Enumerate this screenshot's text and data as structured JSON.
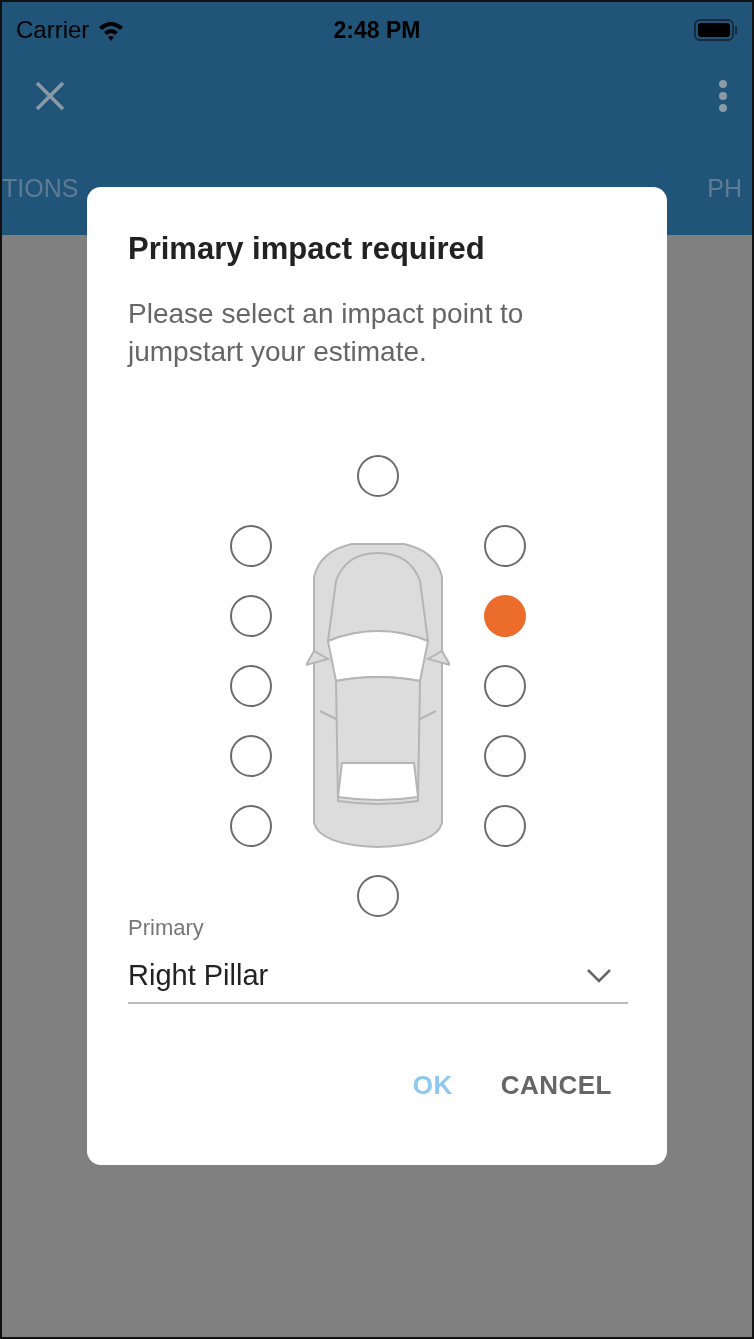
{
  "status_bar": {
    "carrier": "Carrier",
    "time": "2:48 PM"
  },
  "tabs": [
    {
      "label": "TIONS",
      "selected": false
    },
    {
      "label": "PH",
      "selected": false
    }
  ],
  "dialog": {
    "title": "Primary impact required",
    "message": "Please select an impact point to jumpstart your estimate.",
    "impact_points": {
      "front": {
        "selected": false
      },
      "left": [
        {
          "selected": false
        },
        {
          "selected": false
        },
        {
          "selected": false
        },
        {
          "selected": false
        },
        {
          "selected": false
        }
      ],
      "right": [
        {
          "selected": false
        },
        {
          "selected": true
        },
        {
          "selected": false
        },
        {
          "selected": false
        },
        {
          "selected": false
        }
      ],
      "rear": {
        "selected": false
      }
    },
    "select": {
      "label": "Primary",
      "value": "Right Pillar"
    },
    "buttons": [
      {
        "label": "OK",
        "kind": "primary"
      },
      {
        "label": "CANCEL",
        "kind": "secondary"
      }
    ]
  }
}
